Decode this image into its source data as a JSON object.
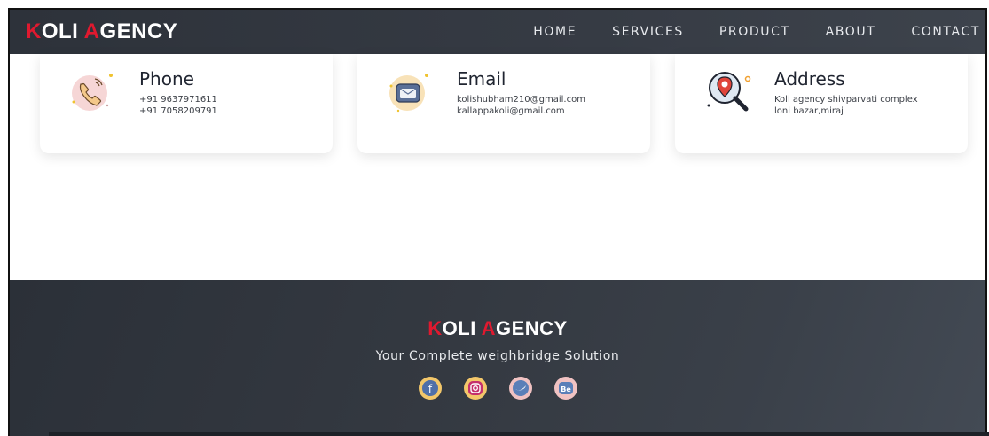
{
  "brand": {
    "first_letter": "K",
    "first_rest": "OLI ",
    "second_letter": "A",
    "second_rest": "GENCY"
  },
  "nav": {
    "items": [
      {
        "label": "HOME"
      },
      {
        "label": "SERVICES"
      },
      {
        "label": "PRODUCT"
      },
      {
        "label": "ABOUT"
      },
      {
        "label": "CONTACT"
      }
    ]
  },
  "contact": {
    "phone": {
      "title": "Phone",
      "lines": [
        "+91 9637971611",
        "+91 7058209791"
      ],
      "icon": "phone-icon"
    },
    "email": {
      "title": "Email",
      "lines": [
        "kolishubham210@gmail.com",
        "kallappakoli@gmail.com"
      ],
      "icon": "envelope-icon"
    },
    "address": {
      "title": "Address",
      "lines": [
        "Koli agency shivparvati complex",
        "loni bazar,miraj"
      ],
      "icon": "location-search-icon"
    }
  },
  "footer": {
    "tagline": "Your Complete weighbridge Solution",
    "socials": [
      {
        "icon": "facebook-icon",
        "glyph": "f"
      },
      {
        "icon": "instagram-icon",
        "glyph": "◎"
      },
      {
        "icon": "twitter-icon",
        "glyph": "✓"
      },
      {
        "icon": "behance-icon",
        "glyph": "Be"
      }
    ]
  },
  "colors": {
    "accent": "#e0192f",
    "dark": "#2d323a"
  }
}
